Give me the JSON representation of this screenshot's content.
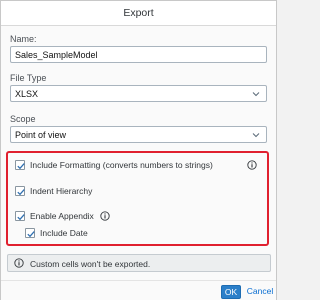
{
  "dialog": {
    "title": "Export",
    "name_label": "Name:",
    "name_value": "Sales_SampleModel",
    "file_type_label": "File Type",
    "file_type_value": "XLSX",
    "scope_label": "Scope",
    "scope_value": "Point of view",
    "options": {
      "include_formatting": {
        "label": "Include Formatting (converts numbers to strings)",
        "checked": true
      },
      "indent_hierarchy": {
        "label": "Indent Hierarchy",
        "checked": true
      },
      "enable_appendix": {
        "label": "Enable Appendix",
        "checked": true
      },
      "include_date": {
        "label": "Include Date",
        "checked": true
      }
    },
    "notice": "Custom cells won't be exported.",
    "ok_label": "OK",
    "cancel_label": "Cancel"
  },
  "colors": {
    "highlight_border": "#e0202f",
    "primary_button": "#2b7fc9",
    "link": "#0a6ed1"
  },
  "icons": {
    "dropdown": "chevron-down-icon",
    "info": "info-icon",
    "checkbox": "checkmark-icon"
  }
}
